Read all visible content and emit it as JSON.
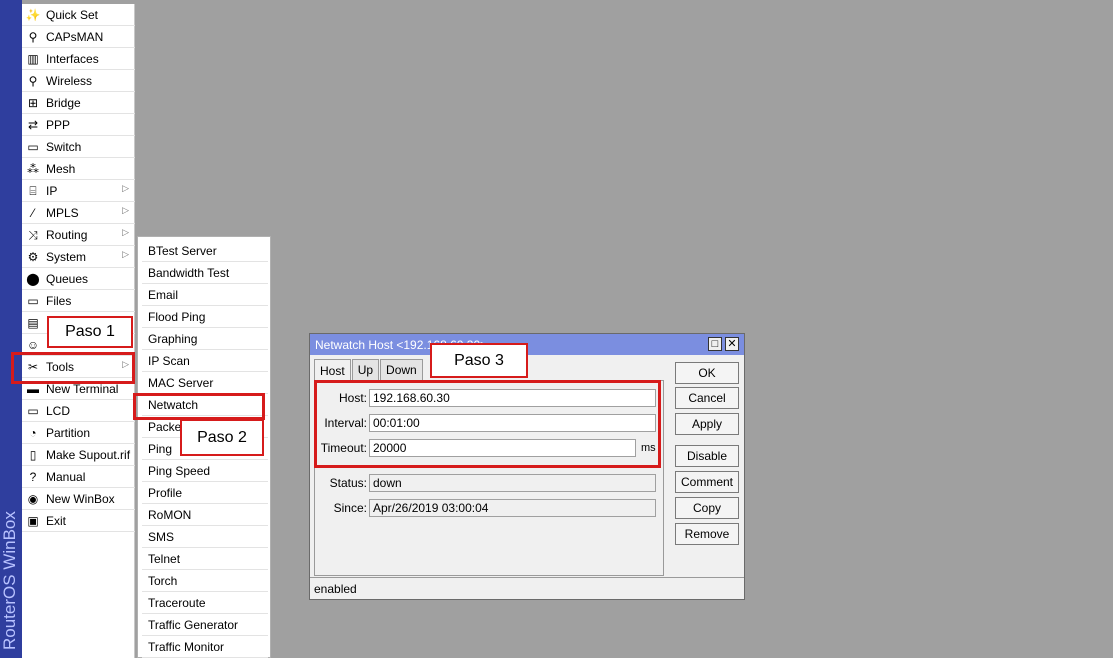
{
  "brand": {
    "text": "RouterOS WinBox",
    "bar_color": "#2f3e9e"
  },
  "main_menu": {
    "items": [
      {
        "label": "Quick Set",
        "icon": "wand-icon",
        "glyph": "✨",
        "submenu": false
      },
      {
        "label": "CAPsMAN",
        "icon": "antenna-icon",
        "glyph": "⚲",
        "submenu": false
      },
      {
        "label": "Interfaces",
        "icon": "interfaces-icon",
        "glyph": "▥",
        "submenu": false
      },
      {
        "label": "Wireless",
        "icon": "wireless-icon",
        "glyph": "⚲",
        "submenu": false
      },
      {
        "label": "Bridge",
        "icon": "bridge-icon",
        "glyph": "⊞",
        "submenu": false
      },
      {
        "label": "PPP",
        "icon": "ppp-icon",
        "glyph": "⇄",
        "submenu": false
      },
      {
        "label": "Switch",
        "icon": "switch-icon",
        "glyph": "▭",
        "submenu": false
      },
      {
        "label": "Mesh",
        "icon": "mesh-icon",
        "glyph": "⁂",
        "submenu": false
      },
      {
        "label": "IP",
        "icon": "ip-icon",
        "glyph": "⌸",
        "submenu": true
      },
      {
        "label": "MPLS",
        "icon": "mpls-icon",
        "glyph": "⁄",
        "submenu": true
      },
      {
        "label": "Routing",
        "icon": "routing-icon",
        "glyph": "⤨",
        "submenu": true
      },
      {
        "label": "System",
        "icon": "gear-icon",
        "glyph": "⚙",
        "submenu": true
      },
      {
        "label": "Queues",
        "icon": "queues-icon",
        "glyph": "⬤",
        "submenu": false
      },
      {
        "label": "Files",
        "icon": "folder-icon",
        "glyph": "▭",
        "submenu": false
      },
      {
        "label": "",
        "icon": "log-icon",
        "glyph": "▤",
        "submenu": false
      },
      {
        "label": "",
        "icon": "users-icon",
        "glyph": "☺",
        "submenu": false
      },
      {
        "label": "Tools",
        "icon": "tools-icon",
        "glyph": "✂",
        "submenu": true
      },
      {
        "label": "New Terminal",
        "icon": "terminal-icon",
        "glyph": "▬",
        "submenu": false
      },
      {
        "label": "LCD",
        "icon": "lcd-icon",
        "glyph": "▭",
        "submenu": false
      },
      {
        "label": "Partition",
        "icon": "partition-icon",
        "glyph": "◔",
        "submenu": false
      },
      {
        "label": "Make Supout.rif",
        "icon": "file-icon",
        "glyph": "▯",
        "submenu": false
      },
      {
        "label": "Manual",
        "icon": "help-icon",
        "glyph": "?",
        "submenu": false
      },
      {
        "label": "New WinBox",
        "icon": "globe-icon",
        "glyph": "◉",
        "submenu": false
      },
      {
        "label": "Exit",
        "icon": "exit-icon",
        "glyph": "▣",
        "submenu": false
      }
    ]
  },
  "tools_submenu": {
    "items": [
      "BTest Server",
      "Bandwidth Test",
      "Email",
      "Flood Ping",
      "Graphing",
      "IP Scan",
      "MAC Server",
      "Netwatch",
      "Packet",
      "Ping",
      "Ping Speed",
      "Profile",
      "RoMON",
      "SMS",
      "Telnet",
      "Torch",
      "Traceroute",
      "Traffic Generator",
      "Traffic Monitor"
    ]
  },
  "callouts": {
    "step1": "Paso 1",
    "step2": "Paso 2",
    "step3": "Paso 3"
  },
  "highlight_color": "#d61b1b",
  "netwatch_window": {
    "title": "Netwatch Host <192.168.60.30>",
    "tabs": [
      "Host",
      "Up",
      "Down"
    ],
    "fields": {
      "host_label": "Host:",
      "host_value": "192.168.60.30",
      "interval_label": "Interval:",
      "interval_value": "00:01:00",
      "timeout_label": "Timeout:",
      "timeout_value": "20000",
      "timeout_unit": "ms",
      "status_label": "Status:",
      "status_value": "down",
      "since_label": "Since:",
      "since_value": "Apr/26/2019 03:00:04"
    },
    "buttons": {
      "ok": "OK",
      "cancel": "Cancel",
      "apply": "Apply",
      "disable": "Disable",
      "comment": "Comment",
      "copy": "Copy",
      "remove": "Remove"
    },
    "status_bar": "enabled",
    "titlebar_color": "#7b8ee0"
  }
}
